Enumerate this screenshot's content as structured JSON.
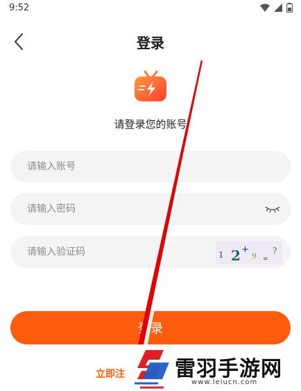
{
  "status": {
    "time": "9:52"
  },
  "header": {
    "title": "登录"
  },
  "subtitle": "请登录您的账号",
  "form": {
    "account_placeholder": "请输入账号",
    "password_placeholder": "请输入密码",
    "captcha_placeholder": "请输入验证码",
    "captcha_image_text": "1 2+ 9 = ?"
  },
  "buttons": {
    "login_label": "登录",
    "register_label": "立即注"
  },
  "watermark": {
    "name": "雷羽手游网",
    "url": "www.leiucn.com"
  },
  "colors": {
    "accent": "#ff5d0d",
    "field_bg": "#f4f4f5"
  },
  "icons": [
    "back-arrow-icon",
    "wifi-icon",
    "signal-icon",
    "battery-icon",
    "eye-closed-icon",
    "tv-flash-logo"
  ]
}
